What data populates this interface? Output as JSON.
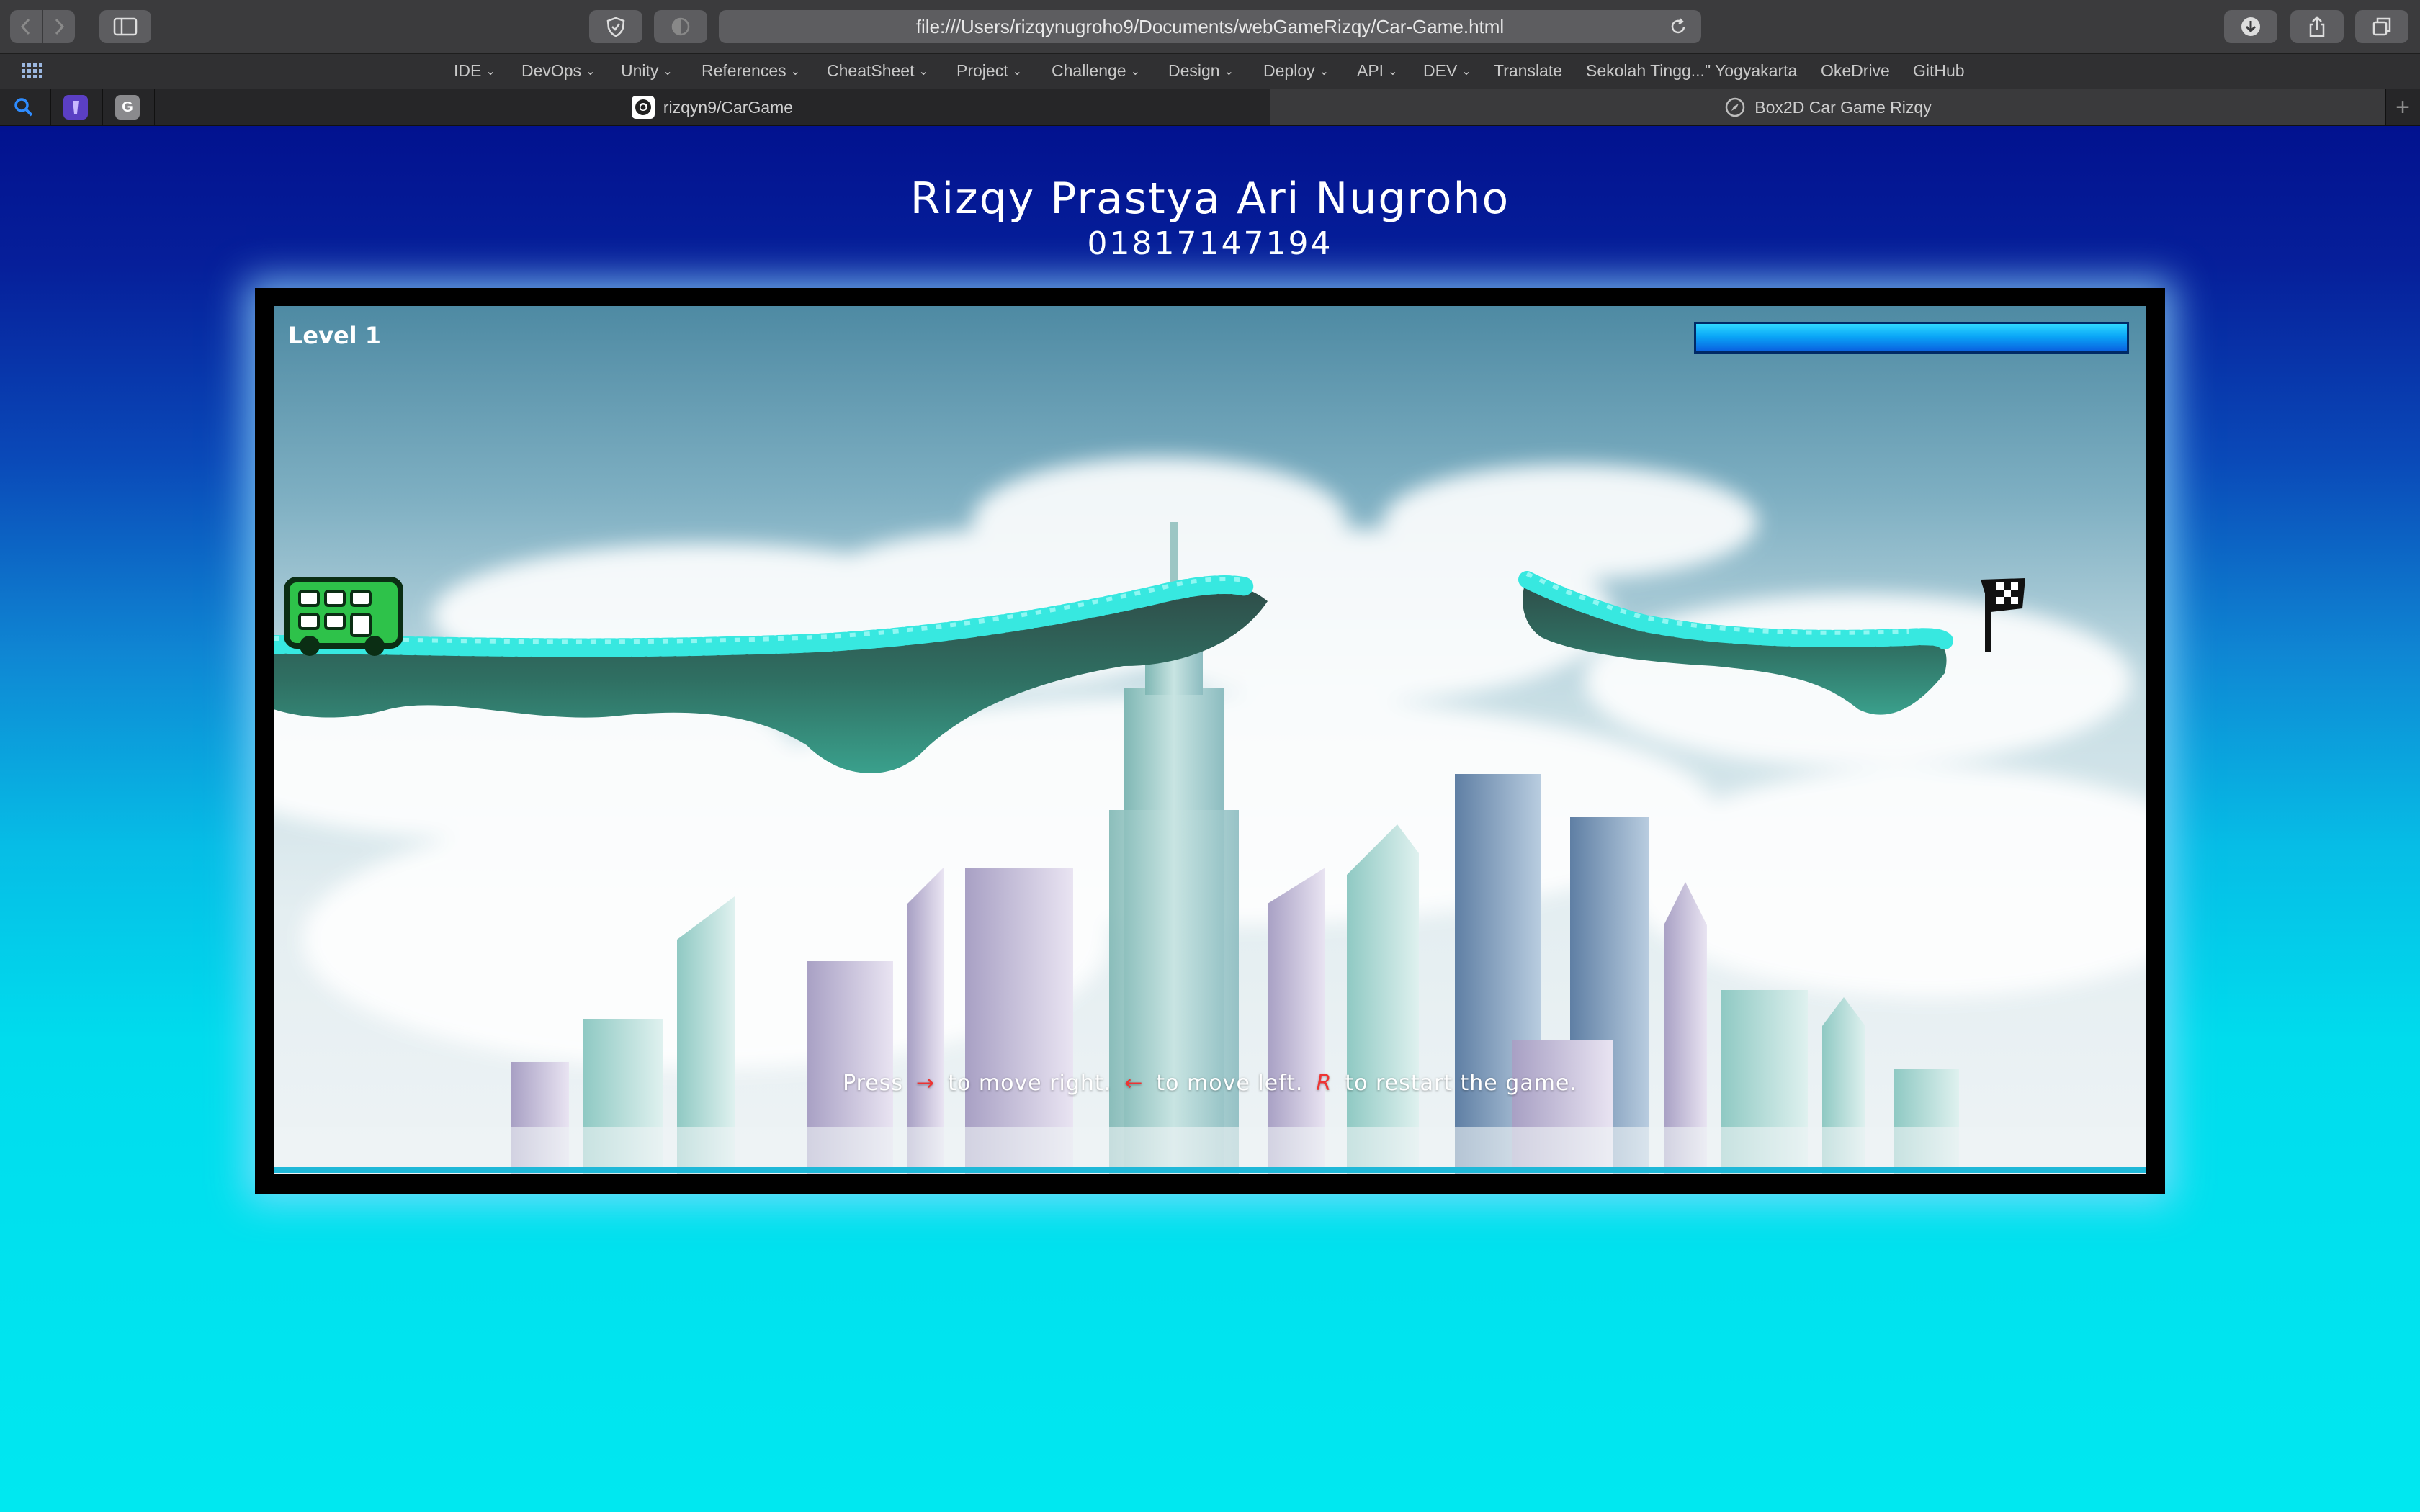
{
  "browser": {
    "url": "file:///Users/rizqynugroho9/Documents/webGameRizqy/Car-Game.html",
    "bookmarks": [
      {
        "label": "IDE",
        "dropdown": true
      },
      {
        "label": "DevOps",
        "dropdown": true
      },
      {
        "label": "Unity",
        "dropdown": true
      },
      {
        "label": "References",
        "dropdown": true
      },
      {
        "label": "CheatSheet",
        "dropdown": true
      },
      {
        "label": "Project",
        "dropdown": true
      },
      {
        "label": "Challenge",
        "dropdown": true
      },
      {
        "label": "Design",
        "dropdown": true
      },
      {
        "label": "Deploy",
        "dropdown": true
      },
      {
        "label": "API",
        "dropdown": true
      },
      {
        "label": "DEV",
        "dropdown": true
      },
      {
        "label": "Translate",
        "dropdown": false
      },
      {
        "label": "Sekolah Tingg...\" Yogyakarta",
        "dropdown": false
      },
      {
        "label": "OkeDrive",
        "dropdown": false
      },
      {
        "label": "GitHub",
        "dropdown": false
      }
    ],
    "pinned_tabs": [
      {
        "icon": "search-icon",
        "letter": ""
      },
      {
        "icon": "extension-icon",
        "letter": ""
      },
      {
        "icon": "g-icon",
        "letter": "G"
      }
    ],
    "tabs": [
      {
        "title": "rizqyn9/CarGame",
        "icon": "github-icon",
        "active": false
      },
      {
        "title": "Box2D Car Game Rizqy",
        "icon": "compass-icon",
        "active": true
      }
    ]
  },
  "page": {
    "player_name": "Rizqy Prastya Ari Nugroho",
    "player_id": "01817147194"
  },
  "game": {
    "level_label": "Level 1",
    "progress_fraction": 1.0,
    "instructions": {
      "press": "Press",
      "right_key": "→",
      "right_text": "to move right.",
      "left_key": "←",
      "left_text": "to move left.",
      "restart_key": "R",
      "restart_text": "to restart the game."
    },
    "colors": {
      "grass": "#37e8e0",
      "ground": "#2f6f62",
      "car_body": "#2ec24a",
      "flag": "#111111",
      "key_color": "#e33333"
    }
  }
}
